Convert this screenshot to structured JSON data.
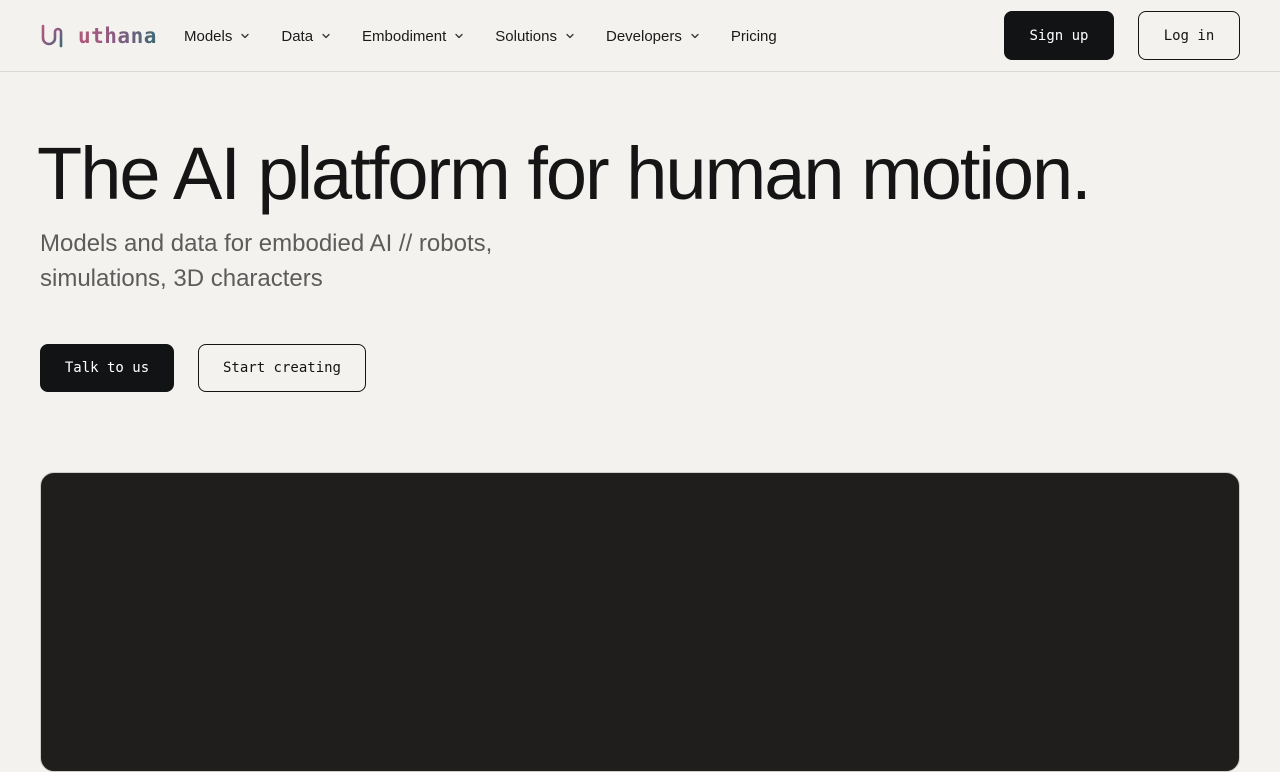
{
  "brand": {
    "name": "uthana",
    "logo_icon": "uthana-logo-icon",
    "gradient_colors": [
      "#b3587a",
      "#8c5a83",
      "#3d6a76"
    ]
  },
  "nav": {
    "items": [
      {
        "label": "Models",
        "has_dropdown": true,
        "icon": "chevron-down-icon"
      },
      {
        "label": "Data",
        "has_dropdown": true,
        "icon": "chevron-down-icon"
      },
      {
        "label": "Embodiment",
        "has_dropdown": true,
        "icon": "chevron-down-icon"
      },
      {
        "label": "Solutions",
        "has_dropdown": true,
        "icon": "chevron-down-icon"
      },
      {
        "label": "Developers",
        "has_dropdown": true,
        "icon": "chevron-down-icon"
      },
      {
        "label": "Pricing",
        "has_dropdown": false
      }
    ]
  },
  "auth": {
    "signup_label": "Sign up",
    "login_label": "Log in"
  },
  "hero": {
    "title": "The AI platform for human motion.",
    "subtitle_line1": "Models and data for embodied AI // robots,",
    "subtitle_line2": "simulations, 3D characters",
    "cta_primary": "Talk to us",
    "cta_secondary": "Start creating"
  },
  "colors": {
    "background": "#f3f2ee",
    "primary_button": "#121314",
    "media_panel": "#1f1e1c"
  }
}
